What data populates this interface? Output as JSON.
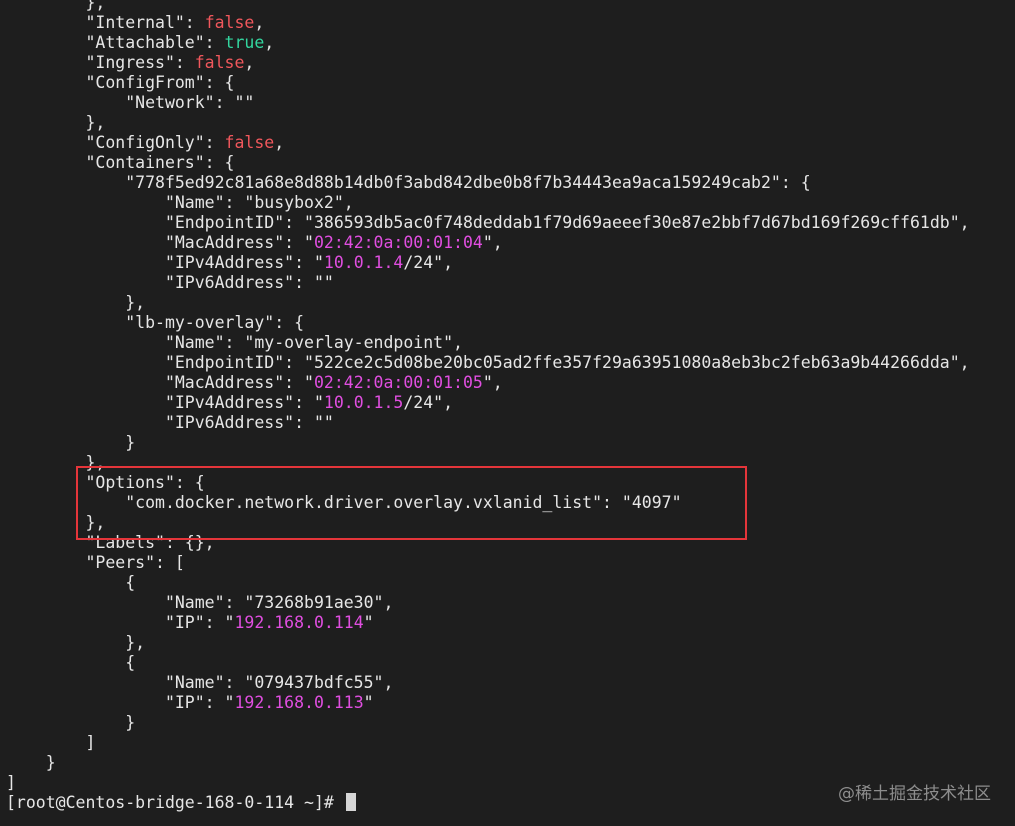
{
  "lines": [
    "        },",
    "        \"Internal\": false,",
    "        \"Attachable\": true,",
    "        \"Ingress\": false,",
    "        \"ConfigFrom\": {",
    "            \"Network\": \"\"",
    "        },",
    "        \"ConfigOnly\": false,",
    "        \"Containers\": {",
    "            \"778f5ed92c81a68e8d88b14db0f3abd842dbe0b8f7b34443ea9aca159249cab2\": {",
    "                \"Name\": \"busybox2\",",
    "                \"EndpointID\": \"386593db5ac0f748deddab1f79d69aeeef30e87e2bbf7d67bd169f269cff61db\",",
    "                \"MacAddress\": \"02:42:0a:00:01:04\",",
    "                \"IPv4Address\": \"10.0.1.4/24\",",
    "                \"IPv6Address\": \"\"",
    "            },",
    "            \"lb-my-overlay\": {",
    "                \"Name\": \"my-overlay-endpoint\",",
    "                \"EndpointID\": \"522ce2c5d08be20bc05ad2ffe357f29a63951080a8eb3bc2feb63a9b44266dda\",",
    "                \"MacAddress\": \"02:42:0a:00:01:05\",",
    "                \"IPv4Address\": \"10.0.1.5/24\",",
    "                \"IPv6Address\": \"\"",
    "            }",
    "        },",
    "        \"Options\": {",
    "            \"com.docker.network.driver.overlay.vxlanid_list\": \"4097\"",
    "        },",
    "        \"Labels\": {},",
    "        \"Peers\": [",
    "            {",
    "                \"Name\": \"73268b91ae30\",",
    "                \"IP\": \"192.168.0.114\"",
    "            },",
    "            {",
    "                \"Name\": \"079437bdfc55\",",
    "                \"IP\": \"192.168.0.113\"",
    "            }",
    "        ]",
    "    }",
    "]"
  ],
  "prompt": "[root@Centos-bridge-168-0-114 ~]# ",
  "watermark": "@稀土掘金技术社区",
  "colors": {
    "background": "#1e1e1e",
    "text": "#e6e6e6",
    "boolean_false": "#f0575c",
    "boolean_true": "#33d69f",
    "address_values": "#e04ee0",
    "highlight_box": "#e5353a",
    "watermark": "#8d8d8d"
  }
}
